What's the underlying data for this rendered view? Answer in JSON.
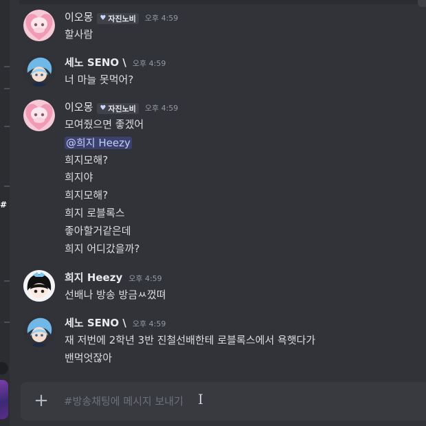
{
  "messages": [
    {
      "author": "이오몽",
      "badge": "자진노비",
      "time": "오후 4:59",
      "lines": [
        "할사람"
      ]
    },
    {
      "author": "세노 SENO \\",
      "time": "오후 4:59",
      "lines": [
        "너 마늘 못먹어?"
      ]
    },
    {
      "author": "이오몽",
      "badge": "자진노비",
      "time": "오후 4:59",
      "lines": [
        "모여줬으면 좋겠어",
        "희지모해?",
        "희지야",
        "희지모해?",
        "희지 로블록스",
        "좋아할거같은데",
        "희지 어디갔을까?"
      ],
      "mention": "@희지 Heezy"
    },
    {
      "author": "희지 Heezy",
      "time": "오후 4:59",
      "lines": [
        "선배나 방송 방금ㅆ껐뗘"
      ]
    },
    {
      "author": "세노 SENO \\",
      "time": "오후 4:59",
      "lines": [
        "재 저번에 2학년 3반 진철선배한테 로블록스에서 욕햇다가",
        "밴먹엇잖아"
      ]
    }
  ],
  "composer": {
    "placeholder": "#방송채팅에 메시지 보내기"
  },
  "colors": {
    "background": "#323339",
    "mention_bg": "#3c4270",
    "composer_bg": "#383a40"
  },
  "icons": [
    "plus-icon",
    "heart-icon",
    "text-cursor-icon"
  ]
}
